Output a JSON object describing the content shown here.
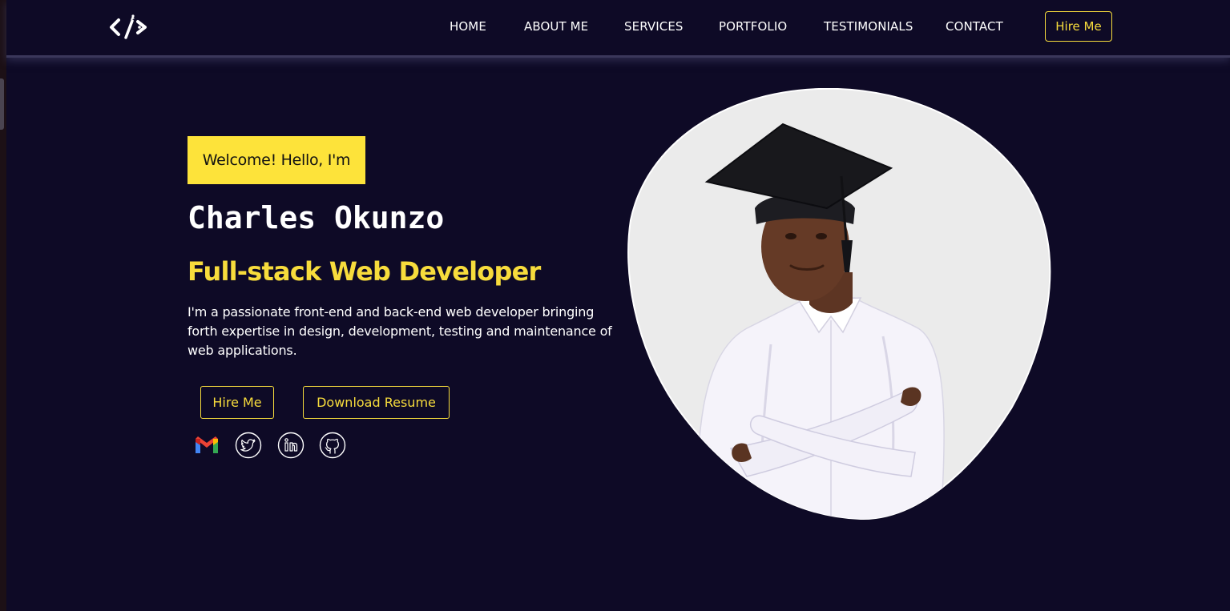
{
  "nav": {
    "links": [
      "HOME",
      "ABOUT ME",
      "SERVICES",
      "PORTFOLIO",
      "TESTIMONIALS",
      "CONTACT"
    ],
    "hire_label": "Hire Me"
  },
  "hero": {
    "welcome": "Welcome! Hello, I'm",
    "name": "Charles Okunzo",
    "role": "Full-stack Web Developer",
    "bio": "I'm a passionate front-end and back-end web developer bringing forth expertise in design, development, testing and maintenance of web applications.",
    "hire_button": "Hire Me",
    "resume_button": "Download Resume"
  },
  "social": [
    "gmail-icon",
    "twitter-icon",
    "linkedin-icon",
    "github-icon"
  ],
  "colors": {
    "background": "#0e0a26",
    "accent": "#f7dc3c",
    "welcome_bg": "#fde33a",
    "photo_bg": "#ebebeb"
  }
}
